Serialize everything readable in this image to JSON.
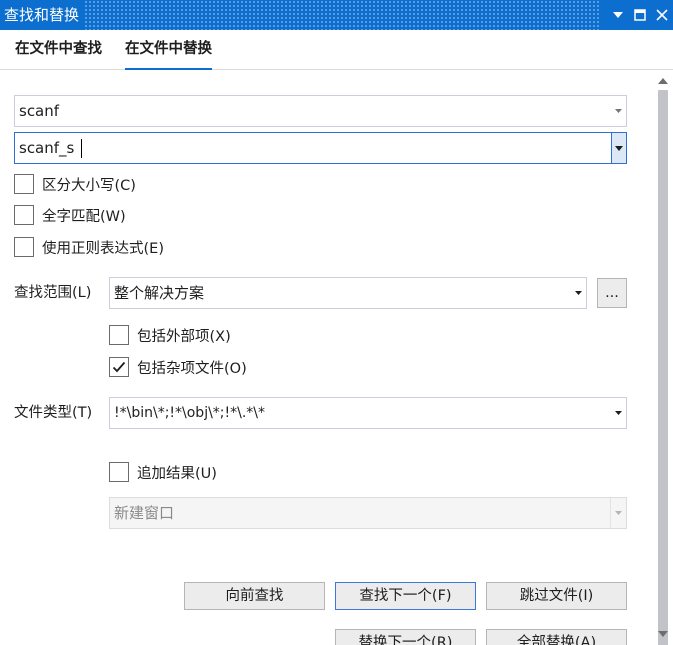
{
  "window": {
    "title": "查找和替换"
  },
  "tabs": [
    {
      "label": "在文件中查找"
    },
    {
      "label": "在文件中替换"
    }
  ],
  "find_field": {
    "value": "scanf"
  },
  "replace_field": {
    "value": "scanf_s"
  },
  "options": {
    "match_case": {
      "label": "区分大小写(C)",
      "checked": false
    },
    "whole_word": {
      "label": "全字匹配(W)",
      "checked": false
    },
    "regex": {
      "label": "使用正则表达式(E)",
      "checked": false
    }
  },
  "scope": {
    "label": "查找范围(L)",
    "value": "整个解决方案",
    "browse_label": "...",
    "include_external": {
      "label": "包括外部项(X)",
      "checked": false
    },
    "include_misc": {
      "label": "包括杂项文件(O)",
      "checked": true
    }
  },
  "file_types": {
    "label": "文件类型(T)",
    "value": "!*\\bin\\*;!*\\obj\\*;!*\\.*\\*"
  },
  "append_results": {
    "label": "追加结果(U)",
    "checked": false
  },
  "output_target": {
    "value": "新建窗口"
  },
  "buttons": {
    "find_previous": "向前查找",
    "find_next": "查找下一个(F)",
    "skip_file": "跳过文件(I)",
    "replace_next": "替换下一个(R)",
    "replace_all": "全部替换(A)"
  },
  "colors": {
    "accent": "#0c6fcf",
    "focus_border": "#2e6fcf"
  },
  "icons": [
    "dropdown-icon",
    "minimize-icon",
    "maximize-icon",
    "close-icon",
    "chevron-down-icon",
    "chevron-up-icon",
    "checkmark-icon"
  ]
}
